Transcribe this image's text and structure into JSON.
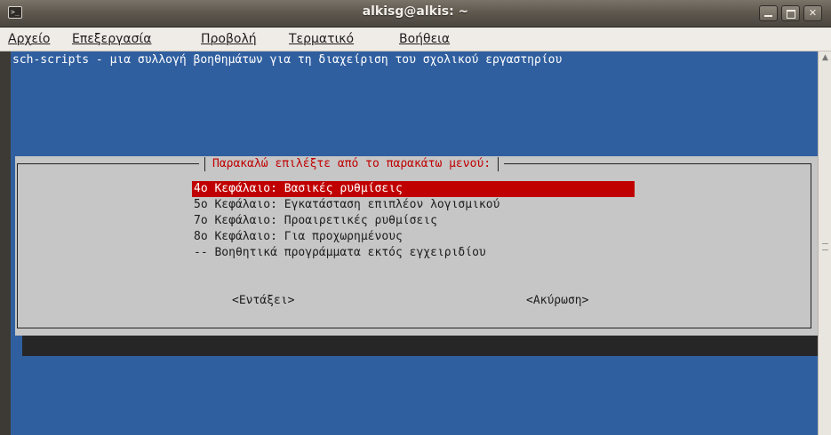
{
  "window": {
    "title": "alkisg@alkis: ~",
    "icon": "terminal-icon",
    "buttons": {
      "minimize": "",
      "maximize": "",
      "close": "✕"
    }
  },
  "menubar": {
    "items": [
      "Αρχείο",
      "Επεξεργασία",
      "Προβολή",
      "Τερματικό",
      "Βοήθεια"
    ]
  },
  "terminal": {
    "header": "sch-scripts - μια συλλογή βοηθημάτων για τη διαχείριση του σχολικού εργαστηρίου",
    "background": "#305fa0"
  },
  "dialog": {
    "title": "Παρακαλώ επιλέξτε από το παρακάτω μενού:",
    "options": [
      "4ο Κεφάλαιο: Βασικές ρυθμίσεις",
      "5ο Κεφάλαιο: Εγκατάσταση επιπλέον λογισμικού",
      "7ο Κεφάλαιο: Προαιρετικές ρυθμίσεις",
      "8ο Κεφάλαιο: Για προχωρημένους",
      "-- Βοηθητικά προγράμματα εκτός εγχειριδίου"
    ],
    "selected_index": 0,
    "ok_label": "<Εντάξει>",
    "cancel_label": "<Ακύρωση>",
    "accent_color": "#c00000"
  }
}
